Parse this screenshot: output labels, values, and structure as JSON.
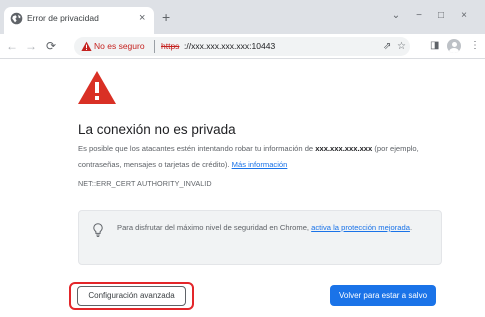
{
  "tab": {
    "title": "Error de privacidad",
    "close_glyph": "×",
    "new_tab_glyph": "+"
  },
  "window_controls": {
    "dropdown_glyph": "⌄",
    "minimize_glyph": "−",
    "maximize_glyph": "□",
    "close_glyph": "×"
  },
  "toolbar": {
    "back_glyph": "←",
    "forward_glyph": "→",
    "reload_glyph": "⟳",
    "security_label": "No es seguro",
    "url_scheme": "https",
    "url_rest": "://xxx.xxx.xxx.xxx:10443",
    "share_glyph": "⇗",
    "star_glyph": "☆",
    "sidepanel_glyph": "◨",
    "menu_glyph": "⋮"
  },
  "interstitial": {
    "heading": "La conexión no es privada",
    "desc_before": "Es posible que los atacantes estén intentando robar tu información de ",
    "desc_host": "xxx.xxx.xxx.xxx",
    "desc_after": " (por ejemplo, contraseñas, mensajes o tarjetas de crédito). ",
    "learn_more": "Más información",
    "error_code": "NET::ERR_CERT AUTHORITY_INVALID",
    "safe_browsing_before": "Para disfrutar del máximo nivel de seguridad en Chrome, ",
    "safe_browsing_link": "activa la protección mejorada",
    "safe_browsing_after": ".",
    "advanced_button": "Configuración avanzada",
    "back_button": "Volver para estar a salvo"
  },
  "colors": {
    "danger": "#c5221f",
    "warning_triangle": "#d93025",
    "primary": "#1a73e8",
    "highlight_outline": "#e3262a",
    "tabstrip": "#dee1e6"
  },
  "icons": {
    "tab_favicon": "globe-icon",
    "omnibox": "warning-triangle-icon",
    "page": "warning-triangle-icon",
    "safe_browsing": "lightbulb-icon"
  }
}
